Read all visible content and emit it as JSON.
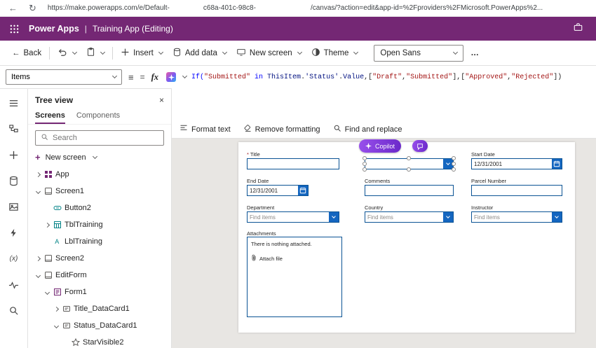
{
  "browser": {
    "url_segments": [
      "https://make.powerapps.com/e/Default-",
      "c68a-401c-98c8-",
      "/canvas/?action=edit&app-id=%2Fproviders%2FMicrosoft.PowerApps%2..."
    ]
  },
  "icons": {
    "back": "←",
    "refresh": "↻",
    "close": "×",
    "menu_lines": "≡",
    "equals": "="
  },
  "header": {
    "brand": "Power Apps",
    "separator": "|",
    "app_title": "Training App (Editing)"
  },
  "command_bar": {
    "back_label": "Back",
    "insert_label": "Insert",
    "add_data_label": "Add data",
    "new_screen_label": "New screen",
    "theme_label": "Theme",
    "font_value": "Open Sans",
    "overflow_label": "…"
  },
  "formula_bar": {
    "property_value": "Items",
    "fx_label": "fx",
    "tokens": [
      {
        "type": "func",
        "text": "If("
      },
      {
        "type": "str",
        "text": "\"Submitted\""
      },
      {
        "type": "kw",
        "text": " in "
      },
      {
        "type": "ident",
        "text": "ThisItem"
      },
      {
        "type": "punc",
        "text": "."
      },
      {
        "type": "ident",
        "text": "'Status'"
      },
      {
        "type": "punc",
        "text": "."
      },
      {
        "type": "ident",
        "text": "Value"
      },
      {
        "type": "punc",
        "text": ",["
      },
      {
        "type": "str",
        "text": "\"Draft\""
      },
      {
        "type": "punc",
        "text": ","
      },
      {
        "type": "str",
        "text": "\"Submitted\""
      },
      {
        "type": "punc",
        "text": "],["
      },
      {
        "type": "str",
        "text": "\"Approved\""
      },
      {
        "type": "punc",
        "text": ","
      },
      {
        "type": "str",
        "text": "\"Rejected\""
      },
      {
        "type": "punc",
        "text": "])"
      }
    ]
  },
  "editor_toolbar": {
    "format_text": "Format text",
    "remove_formatting": "Remove formatting",
    "find_replace": "Find and replace"
  },
  "rail": {
    "items": [
      "menu",
      "tree-view",
      "insert",
      "data",
      "media",
      "power-automate",
      "variables",
      "monitor",
      "search"
    ]
  },
  "tree_panel": {
    "title": "Tree view",
    "tabs": [
      {
        "label": "Screens",
        "active": true
      },
      {
        "label": "Components",
        "active": false
      }
    ],
    "search_placeholder": "Search",
    "new_screen_label": "New screen",
    "items": [
      {
        "label": "App",
        "depth": 0,
        "expand": "collapsed",
        "icon": "app"
      },
      {
        "label": "Screen1",
        "depth": 0,
        "expand": "expanded",
        "icon": "screen"
      },
      {
        "label": "Button2",
        "depth": 1,
        "expand": "none",
        "icon": "button"
      },
      {
        "label": "TblTraining",
        "depth": 1,
        "expand": "collapsed",
        "icon": "table"
      },
      {
        "label": "LblTraining",
        "depth": 1,
        "expand": "none",
        "icon": "label"
      },
      {
        "label": "Screen2",
        "depth": 0,
        "expand": "collapsed",
        "icon": "screen"
      },
      {
        "label": "EditForm",
        "depth": 0,
        "expand": "expanded",
        "icon": "screen"
      },
      {
        "label": "Form1",
        "depth": 1,
        "expand": "expanded",
        "icon": "form"
      },
      {
        "label": "Title_DataCard1",
        "depth": 2,
        "expand": "collapsed",
        "icon": "card"
      },
      {
        "label": "Status_DataCard1",
        "depth": 2,
        "expand": "expanded",
        "icon": "card"
      },
      {
        "label": "StarVisible2",
        "depth": 3,
        "expand": "none",
        "icon": "star"
      }
    ]
  },
  "canvas": {
    "copilot_label": "Copilot",
    "form": {
      "title": {
        "label": "Title",
        "required_mark": "*",
        "value": ""
      },
      "status": {
        "value": ""
      },
      "start_date": {
        "label": "Start Date",
        "value": "12/31/2001"
      },
      "end_date": {
        "label": "End Date",
        "value": "12/31/2001"
      },
      "comments": {
        "label": "Comments",
        "value": ""
      },
      "parcel": {
        "label": "Parcel Number",
        "value": ""
      },
      "department": {
        "label": "Department",
        "placeholder": "Find items"
      },
      "country": {
        "label": "Country",
        "placeholder": "Find items"
      },
      "instructor": {
        "label": "Instructor",
        "placeholder": "Find items"
      },
      "attachments": {
        "label": "Attachments",
        "empty_text": "There is nothing attached.",
        "attach_label": "Attach file"
      }
    }
  },
  "colors": {
    "brand_purple": "#742774",
    "copilot_purple": "#7b3fd4",
    "field_border": "#0b5394",
    "field_button": "#1466c0",
    "string_token": "#a31515",
    "keyword_token": "#0000ff"
  }
}
